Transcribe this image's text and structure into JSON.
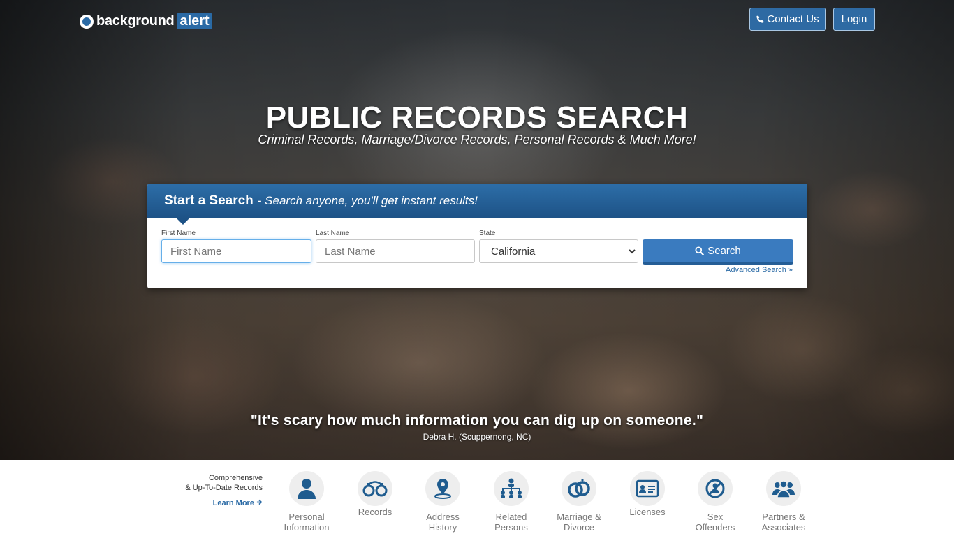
{
  "header": {
    "logo_word": "background",
    "logo_accent": "alert",
    "contact_label": "Contact Us",
    "login_label": "Login"
  },
  "hero": {
    "title": "PUBLIC RECORDS SEARCH",
    "subtitle": "Criminal Records, Marriage/Divorce Records, Personal Records & Much More!"
  },
  "search": {
    "heading": "Start a Search",
    "tagline": "- Search anyone, you'll get instant results!",
    "first_name_label": "First Name",
    "first_name_placeholder": "First Name",
    "last_name_label": "Last Name",
    "last_name_placeholder": "Last Name",
    "state_label": "State",
    "state_value": "California",
    "search_label": "Search",
    "advanced_label": "Advanced Search »"
  },
  "testimonial": {
    "quote": "\"It's scary how much information you can dig up on someone.\"",
    "author": "Debra H. (Scuppernong, NC)"
  },
  "promo": {
    "line1": "Comprehensive",
    "line2": "& Up-To-Date Records",
    "link": "Learn More"
  },
  "categories": [
    {
      "line1": "Personal",
      "line2": "Information",
      "icon": "person-icon"
    },
    {
      "line1": "Records",
      "line2": "",
      "icon": "handcuffs-icon"
    },
    {
      "line1": "Address",
      "line2": "History",
      "icon": "map-pin-icon"
    },
    {
      "line1": "Related",
      "line2": "Persons",
      "icon": "family-tree-icon"
    },
    {
      "line1": "Marriage &",
      "line2": "Divorce",
      "icon": "rings-icon"
    },
    {
      "line1": "Licenses",
      "line2": "",
      "icon": "id-card-icon"
    },
    {
      "line1": "Sex",
      "line2": "Offenders",
      "icon": "prohibited-icon"
    },
    {
      "line1": "Partners &",
      "line2": "Associates",
      "icon": "group-icon"
    }
  ],
  "colors": {
    "brand_blue": "#2a6aa5",
    "button_blue": "#3a7bbf",
    "icon_blue": "#1f5c8f"
  }
}
